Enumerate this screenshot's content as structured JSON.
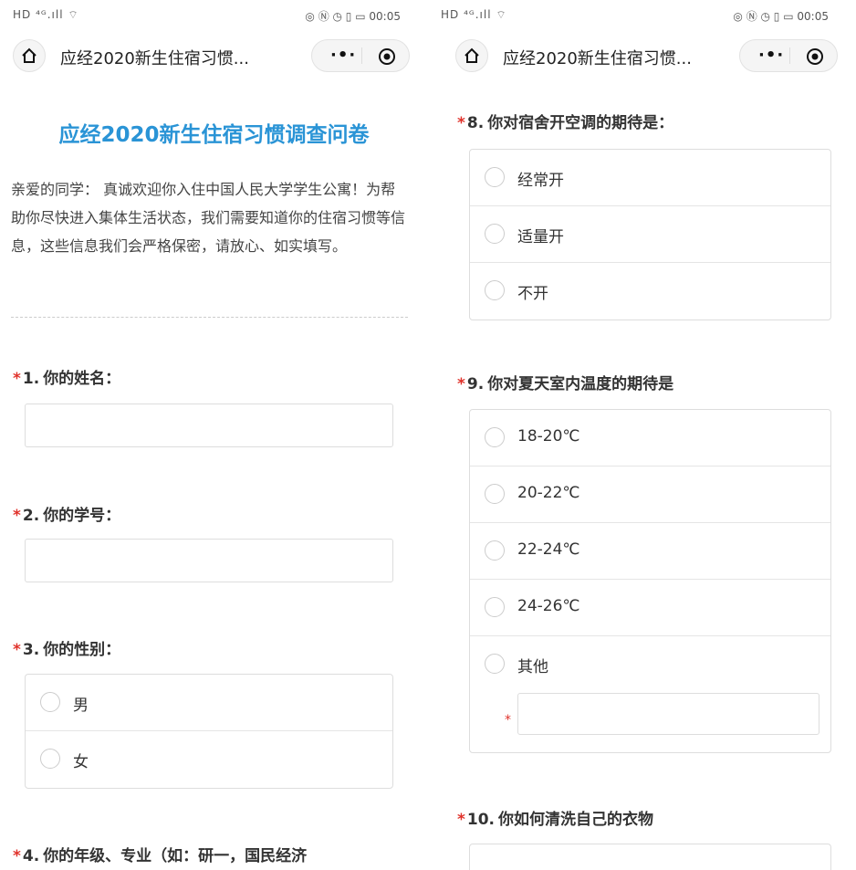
{
  "status_bar": {
    "left_icons": "HD ⁴ᴳ.ıll ⌔",
    "right_icons": "◎ Ⓝ ◷ ▯ ▭",
    "time": "00:05"
  },
  "navbar": {
    "title": "应经2020新生住宿习惯...",
    "more_icon": "more-dots-icon",
    "close_icon": "target-icon",
    "home_icon": "home-icon"
  },
  "survey": {
    "title": "应经2020新生住宿习惯调查问卷",
    "intro": "亲爱的同学： 真诚欢迎你入住中国人民大学学生公寓！为帮助你尽快进入集体生活状态，我们需要知道你的住宿习惯等信息，这些信息我们会严格保密，请放心、如实填写。"
  },
  "questions": {
    "q1": {
      "required": "*",
      "number": "1.",
      "label": "你的姓名："
    },
    "q2": {
      "required": "*",
      "number": "2.",
      "label": "你的学号："
    },
    "q3": {
      "required": "*",
      "number": "3.",
      "label": "你的性别：",
      "options": [
        "男",
        "女"
      ]
    },
    "q4": {
      "required": "*",
      "number": "4.",
      "label": "你的年级、专业（如：研一，国民经济"
    },
    "q8": {
      "required": "*",
      "number": "8.",
      "label": "你对宿舍开空调的期待是：",
      "options": [
        "经常开",
        "适量开",
        "不开"
      ]
    },
    "q9": {
      "required": "*",
      "number": "9.",
      "label": "你对夏天室内温度的期待是",
      "options": [
        "18-20℃",
        "20-22℃",
        "22-24℃",
        "24-26℃",
        "其他"
      ],
      "other_required": "*"
    },
    "q10": {
      "required": "*",
      "number": "10.",
      "label": "你如何清洗自己的衣物"
    }
  }
}
